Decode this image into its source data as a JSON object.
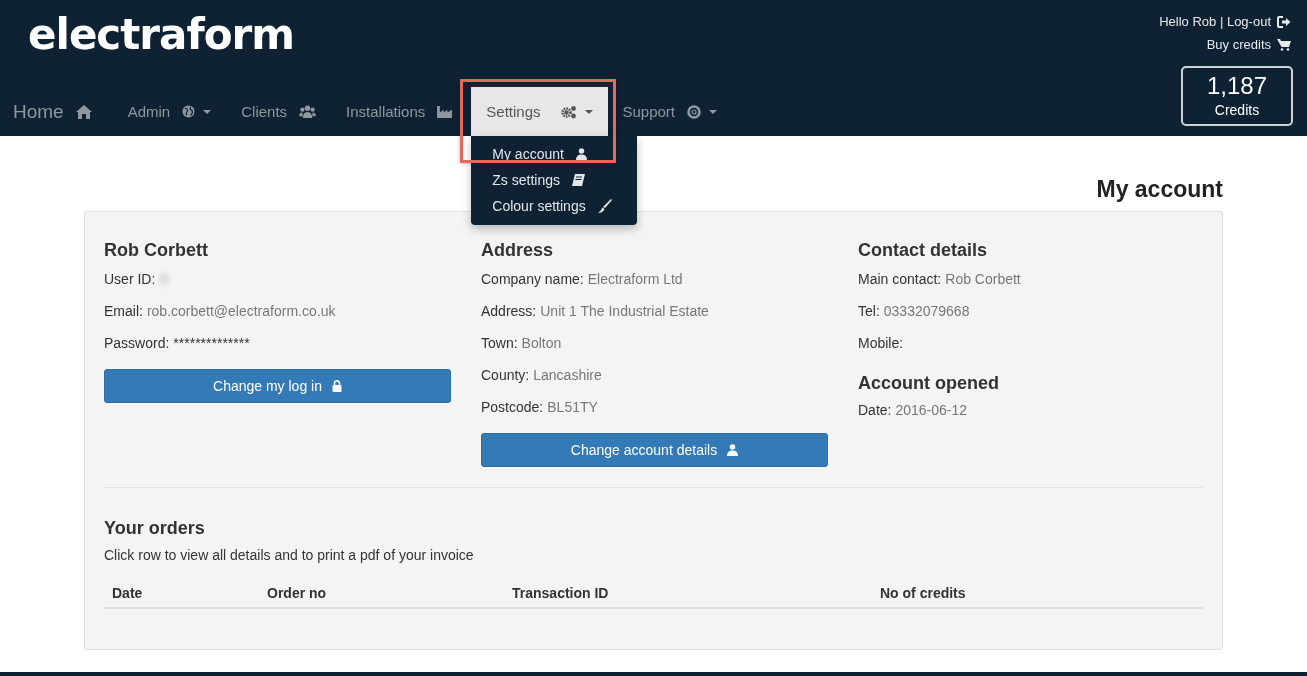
{
  "header": {
    "logo": "electraform",
    "greeting": "Hello Rob | Log-out",
    "buy_credits": "Buy credits",
    "credits": {
      "count": "1,187",
      "label": "Credits"
    }
  },
  "nav": [
    {
      "label": "Home",
      "selected": false,
      "kind": "brand"
    },
    {
      "label": "Admin",
      "selected": false,
      "kind": "dropdown"
    },
    {
      "label": "Clients",
      "selected": false,
      "kind": "link"
    },
    {
      "label": "Installations",
      "selected": false,
      "kind": "link"
    },
    {
      "label": "Settings",
      "selected": true,
      "kind": "dropdown",
      "highlighted": true,
      "menu": [
        {
          "label": "My account"
        },
        {
          "label": "Zs settings"
        },
        {
          "label": "Colour settings"
        }
      ]
    },
    {
      "label": "Support",
      "selected": false,
      "kind": "dropdown"
    }
  ],
  "page_title": "My account",
  "columns": [
    [
      {
        "kind": "heading",
        "text": "Rob Corbett"
      },
      {
        "kind": "redacted",
        "label": "User ID:"
      },
      {
        "kind": "field",
        "label": "Email:",
        "value": "rob.corbett@electraform.co.uk"
      },
      {
        "kind": "secret",
        "label": "Password:",
        "value": "**************"
      },
      {
        "kind": "button",
        "text": "Change my log in"
      }
    ],
    [
      {
        "kind": "heading",
        "text": "Address"
      },
      {
        "kind": "field",
        "label": "Company name:",
        "value": "Electraform Ltd"
      },
      {
        "kind": "field",
        "label": "Address:",
        "value": "Unit 1 The Industrial Estate"
      },
      {
        "kind": "field",
        "label": "Town:",
        "value": "Bolton"
      },
      {
        "kind": "field",
        "label": "County:",
        "value": "Lancashire"
      },
      {
        "kind": "field",
        "label": "Postcode:",
        "value": "BL51TY"
      },
      {
        "kind": "button",
        "text": "Change account details"
      }
    ],
    [
      {
        "kind": "heading",
        "text": "Contact details"
      },
      {
        "kind": "field",
        "label": "Main contact:",
        "value": "Rob Corbett"
      },
      {
        "kind": "field",
        "label": "Tel:",
        "value": "03332079668"
      },
      {
        "kind": "field",
        "label": "Mobile:"
      },
      {
        "kind": "subheading",
        "text": "Account opened"
      },
      {
        "kind": "field",
        "label": "Date:",
        "value": "2016-06-12"
      }
    ]
  ],
  "orders": {
    "title": "Your orders",
    "hint": "Click row to view all details and to print a pdf of your invoice",
    "columns": [
      "Date",
      "Order no",
      "Transaction ID",
      "No of credits"
    ]
  }
}
